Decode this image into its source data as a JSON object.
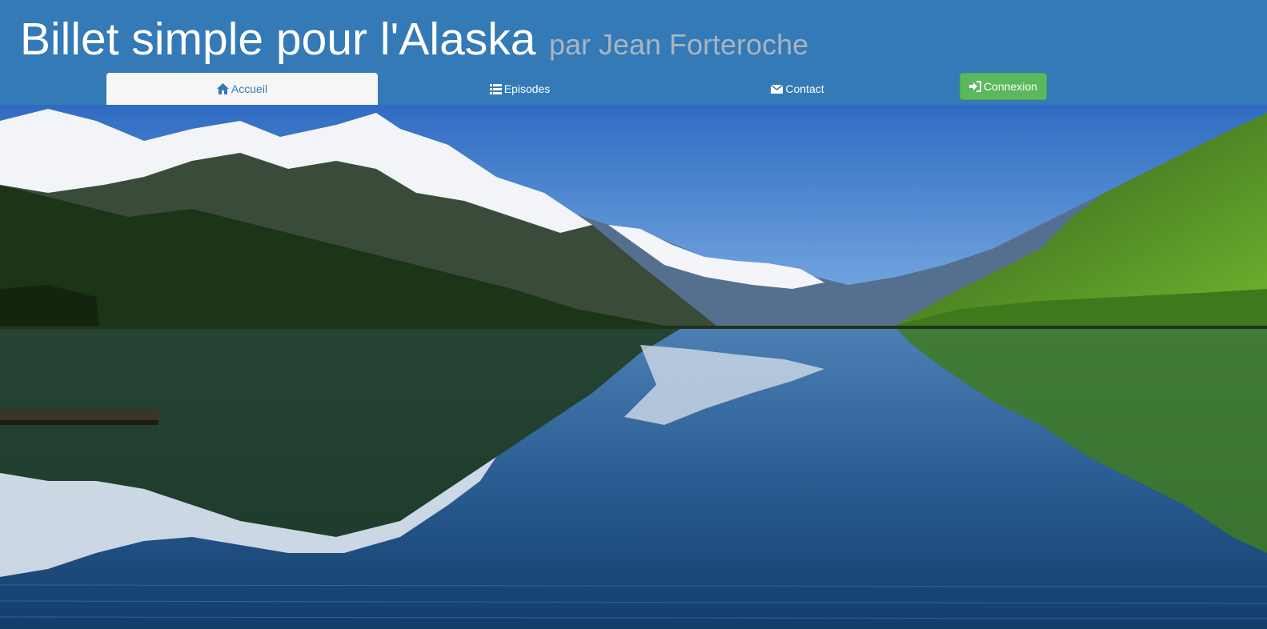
{
  "header": {
    "title": "Billet simple pour l'Alaska",
    "subtitle": "par Jean Forteroche"
  },
  "nav": {
    "items": [
      {
        "label": "Accueil",
        "icon": "home-icon",
        "active": true
      },
      {
        "label": "Episodes",
        "icon": "list-icon",
        "active": false
      },
      {
        "label": "Contact",
        "icon": "envelope-icon",
        "active": false
      }
    ],
    "login_label": "Connexion",
    "login_icon": "log-in-icon"
  },
  "colors": {
    "header_bg": "#337ab7",
    "active_tab_bg": "#f6f6f6",
    "login_bg": "#5cb85c",
    "subtitle": "#a9b4c0"
  },
  "hero": {
    "description_icon": "alaska-lake-mountains-photo"
  }
}
